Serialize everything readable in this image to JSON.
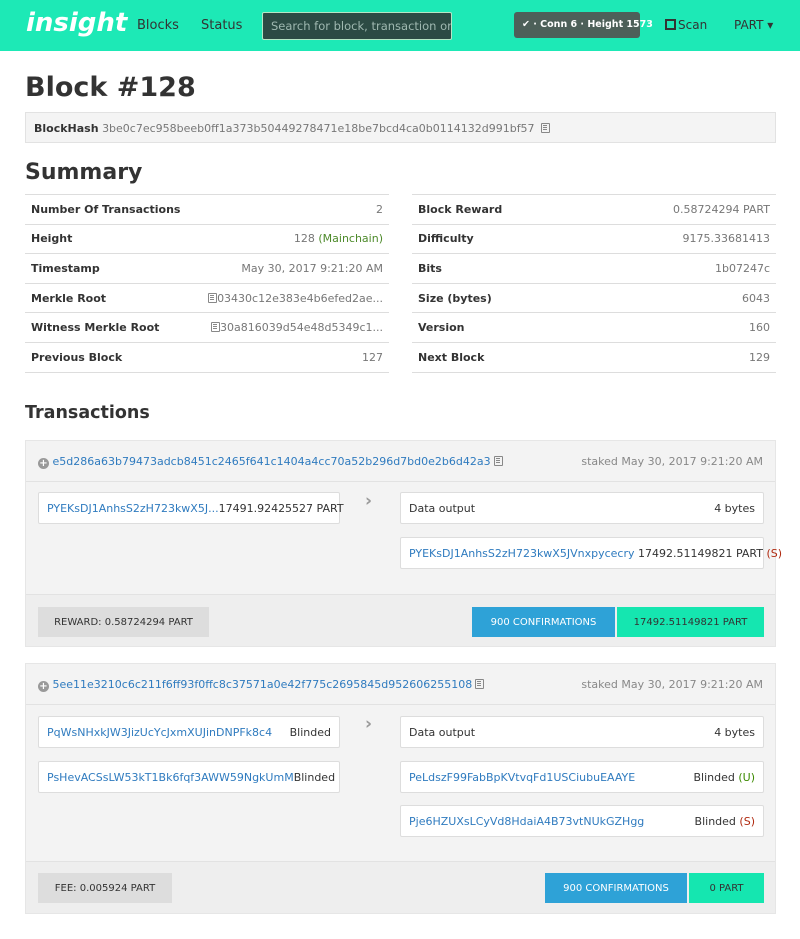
{
  "nav": {
    "brand": "insight",
    "blocks": "Blocks",
    "status": "Status",
    "search_placeholder": "Search for block, transaction or address",
    "conn_status": "✔ · Conn 6 · Height 1573",
    "scan": "Scan",
    "currency": "PART ▾"
  },
  "page": {
    "title": "Block #128",
    "blockhash_label": "BlockHash",
    "blockhash": "3be0c7ec958beeb0ff1a373b50449278471e18be7bcd4ca0b0114132d991bf57",
    "summary_title": "Summary",
    "transactions_title": "Transactions"
  },
  "summary_left": [
    {
      "label": "Number Of Transactions",
      "value": "2"
    },
    {
      "label": "Height",
      "value": "128",
      "extra": "(Mainchain)"
    },
    {
      "label": "Timestamp",
      "value": "May 30, 2017 9:21:20 AM"
    },
    {
      "label": "Merkle Root",
      "value": "03430c12e383e4b6efed2ae..."
    },
    {
      "label": "Witness Merkle Root",
      "value": "30a816039d54e48d5349c1..."
    },
    {
      "label": "Previous Block",
      "value": "127"
    }
  ],
  "summary_right": [
    {
      "label": "Block Reward",
      "value": "0.58724294 PART"
    },
    {
      "label": "Difficulty",
      "value": "9175.33681413"
    },
    {
      "label": "Bits",
      "value": "1b07247c"
    },
    {
      "label": "Size (bytes)",
      "value": "6043"
    },
    {
      "label": "Version",
      "value": "160"
    },
    {
      "label": "Next Block",
      "value": "129"
    }
  ],
  "tx1": {
    "txid": "e5d286a63b79473adcb8451c2465f641c1404a4cc70a52b296d7bd0e2b6d42a3",
    "staked": "staked May 30, 2017 9:21:20 AM",
    "input_addr": "PYEKsDJ1AnhsS2zH723kwX5J...",
    "input_amount": "17491.92425527 PART",
    "out1_label": "Data output",
    "out1_value": "4 bytes",
    "out2_addr": "PYEKsDJ1AnhsS2zH723kwX5JVnxpycecry",
    "out2_amount": "17492.51149821 PART",
    "out2_flag": "(S)",
    "reward": "REWARD: 0.58724294 PART",
    "confirmations": "900 CONFIRMATIONS",
    "total": "17492.51149821 PART"
  },
  "tx2": {
    "txid": "5ee11e3210c6c211f6ff93f0ffc8c37571a0e42f775c2695845d952606255108",
    "staked": "staked May 30, 2017 9:21:20 AM",
    "in1_addr": "PqWsNHxkJW3JizUcYcJxmXUJinDNPFk8c4",
    "in1_amount": "Blinded",
    "in2_addr": "PsHevACSsLW53kT1Bk6fqf3AWW59NgkUmM",
    "in2_amount": "Blinded",
    "out1_label": "Data output",
    "out1_value": "4 bytes",
    "out2_addr": "PeLdszF99FabBpKVtvqFd1USCiubuEAAYE",
    "out2_amount": "Blinded",
    "out2_flag": "(U)",
    "out3_addr": "Pje6HZUXsLCyVd8HdaiA4B73vtNUkGZHgg",
    "out3_amount": "Blinded",
    "out3_flag": "(S)",
    "fee": "FEE: 0.005924 PART",
    "confirmations": "900 CONFIRMATIONS",
    "total": "0 PART"
  }
}
